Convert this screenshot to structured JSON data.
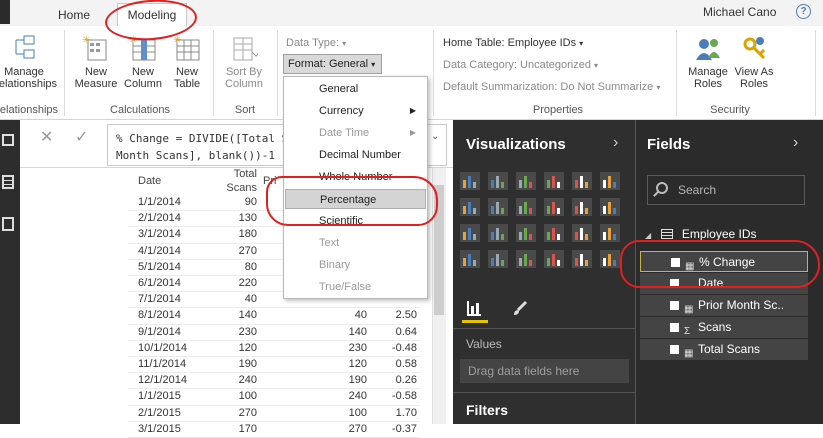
{
  "tabs": {
    "home": "Home",
    "modeling": "Modeling"
  },
  "user": "Michael Cano",
  "help": "?",
  "ribbon": {
    "manage_rel": [
      "Manage",
      "Relationships"
    ],
    "group_relationships": "Relationships",
    "new_measure": [
      "New",
      "Measure"
    ],
    "new_column": [
      "New",
      "Column"
    ],
    "new_table": [
      "New",
      "Table"
    ],
    "group_calculations": "Calculations",
    "sort_by_column": [
      "Sort By",
      "Column"
    ],
    "group_sort": "Sort",
    "data_type": "Data Type:",
    "format": "Format: General",
    "home_table": "Home Table: Employee IDs",
    "data_category": "Data Category: Uncategorized",
    "default_summarization": "Default Summarization: Do Not Summarize",
    "group_properties": "Properties",
    "manage_roles": [
      "Manage",
      "Roles"
    ],
    "view_as_roles": [
      "View As",
      "Roles"
    ],
    "group_security": "Security"
  },
  "format_menu": {
    "general": "General",
    "currency": "Currency",
    "date_time": "Date Time",
    "decimal": "Decimal Number",
    "whole": "Whole Number",
    "percentage": "Percentage",
    "scientific": "Scientific",
    "text": "Text",
    "binary": "Binary",
    "truefalse": "True/False"
  },
  "formula": {
    "text": "% Change = DIVIDE([Total S\nMonth Scans], blank())-1"
  },
  "table": {
    "headers": [
      "Date",
      "Total Scans",
      "Pri",
      ""
    ],
    "rows": [
      [
        "1/1/2014",
        "90",
        "",
        ""
      ],
      [
        "2/1/2014",
        "130",
        "",
        ""
      ],
      [
        "3/1/2014",
        "180",
        "",
        ""
      ],
      [
        "4/1/2014",
        "270",
        "",
        ""
      ],
      [
        "5/1/2014",
        "80",
        "",
        ""
      ],
      [
        "6/1/2014",
        "220",
        "",
        ""
      ],
      [
        "7/1/2014",
        "40",
        "",
        ""
      ],
      [
        "8/1/2014",
        "140",
        "40",
        "2.50"
      ],
      [
        "9/1/2014",
        "230",
        "140",
        "0.64"
      ],
      [
        "10/1/2014",
        "120",
        "230",
        "-0.48"
      ],
      [
        "11/1/2014",
        "190",
        "120",
        "0.58"
      ],
      [
        "12/1/2014",
        "240",
        "190",
        "0.26"
      ],
      [
        "1/1/2015",
        "100",
        "240",
        "-0.58"
      ],
      [
        "2/1/2015",
        "270",
        "100",
        "1.70"
      ],
      [
        "3/1/2015",
        "170",
        "270",
        "-0.37"
      ]
    ]
  },
  "visualizations": {
    "title": "Visualizations",
    "values_label": "Values",
    "drop_hint": "Drag data fields here",
    "filters_label": "Filters"
  },
  "fields": {
    "title": "Fields",
    "search_placeholder": "Search",
    "table_name": "Employee IDs",
    "items": [
      "% Change",
      "Date",
      "Prior Month Sc..",
      "Scans",
      "Total Scans"
    ]
  },
  "colors": {
    "accent_red": "#e02020",
    "panel_dark": "#2b2b2b"
  }
}
